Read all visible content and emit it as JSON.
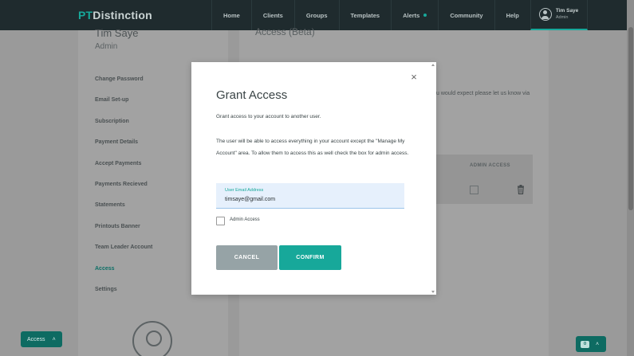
{
  "brand": {
    "prefix": "PT",
    "rest": "Distinction"
  },
  "nav": {
    "items": [
      {
        "label": "Home"
      },
      {
        "label": "Clients"
      },
      {
        "label": "Groups"
      },
      {
        "label": "Templates"
      },
      {
        "label": "Alerts",
        "badge_dot": true
      },
      {
        "label": "Community"
      },
      {
        "label": "Help"
      }
    ],
    "user": {
      "name": "Tim Saye",
      "role": "Admin"
    }
  },
  "sidebar": {
    "name": "Tim Saye",
    "role": "Admin",
    "items": [
      {
        "label": "Change Password"
      },
      {
        "label": "Email Set-up"
      },
      {
        "label": "Subscription"
      },
      {
        "label": "Payment Details"
      },
      {
        "label": "Accept Payments"
      },
      {
        "label": "Payments Recieved"
      },
      {
        "label": "Statements"
      },
      {
        "label": "Printouts Banner"
      },
      {
        "label": "Team Leader Account"
      },
      {
        "label": "Access",
        "active": true
      },
      {
        "label": "Settings"
      }
    ]
  },
  "main": {
    "title": "Access (Beta)",
    "partial_text": "u would expect please let us know via",
    "table": {
      "header_admin": "ADMIN ACCESS"
    }
  },
  "modal": {
    "title": "Grant Access",
    "intro": "Grant access to your account to another user.",
    "description": "The user will be able to access everything in your account except the \"Manage My Account\" area. To allow them to access this as well check the box for admin access.",
    "email": {
      "label": "User Email Address",
      "value": "timsaye@gmail.com"
    },
    "admin_checkbox": {
      "label": "Admin Access",
      "checked": false
    },
    "cancel_label": "CANCEL",
    "confirm_label": "CONFIRM",
    "close_glyph": "×"
  },
  "floating": {
    "access_label": "Access",
    "chat_count": "0"
  },
  "colors": {
    "accent": "#17a89a",
    "nav_bg": "#1f2b2e",
    "cancel_bg": "#96a3a6"
  }
}
